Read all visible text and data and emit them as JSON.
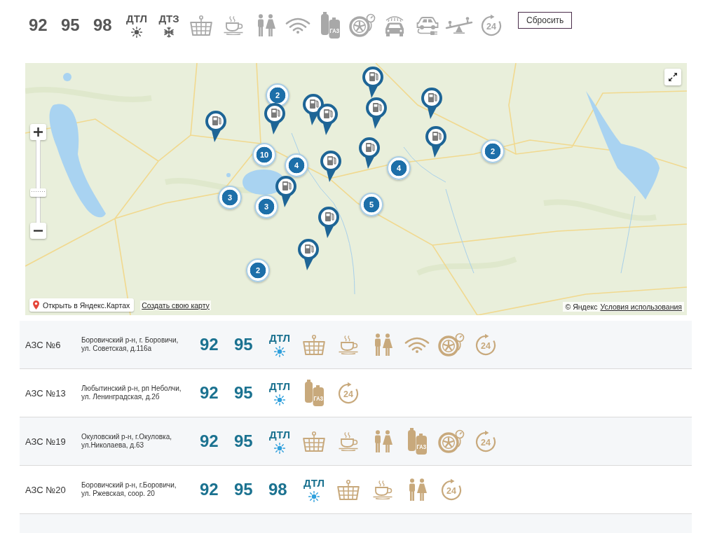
{
  "filters": {
    "fuels": [
      {
        "kind": "grade",
        "label": "92",
        "selected": false
      },
      {
        "kind": "grade",
        "label": "95",
        "selected": false
      },
      {
        "kind": "grade",
        "label": "98",
        "selected": false
      },
      {
        "kind": "summer",
        "label": "ДТЛ",
        "selected": false
      },
      {
        "kind": "winter",
        "label": "ДТЗ",
        "selected": false
      }
    ],
    "services": [
      {
        "kind": "shop",
        "selected": false
      },
      {
        "kind": "cafe",
        "selected": false
      },
      {
        "kind": "wc",
        "selected": false
      },
      {
        "kind": "wifi",
        "selected": false
      },
      {
        "kind": "gas",
        "label": "ГАЗ",
        "selected": false
      },
      {
        "kind": "tire",
        "selected": false
      },
      {
        "kind": "carwash",
        "selected": false
      },
      {
        "kind": "ev",
        "selected": false
      },
      {
        "kind": "playground",
        "selected": false
      },
      {
        "kind": "allday",
        "label": "24",
        "selected": false
      }
    ],
    "reset_button": "Сбросить"
  },
  "map": {
    "clusters": [
      {
        "count": "2"
      },
      {
        "count": "10"
      },
      {
        "count": "4"
      },
      {
        "count": "3"
      },
      {
        "count": "3"
      },
      {
        "count": "2"
      },
      {
        "count": "4"
      },
      {
        "count": "5"
      },
      {
        "count": "2"
      }
    ],
    "pins": [
      {
        "kind": "fuel"
      },
      {
        "kind": "fuel"
      },
      {
        "kind": "fuel"
      },
      {
        "kind": "fuel"
      },
      {
        "kind": "fuel"
      },
      {
        "kind": "fuel"
      },
      {
        "kind": "fuel"
      },
      {
        "kind": "fuel"
      },
      {
        "kind": "fuel"
      },
      {
        "kind": "fuel"
      },
      {
        "kind": "fuel"
      },
      {
        "kind": "fuel"
      },
      {
        "kind": "fuel"
      }
    ],
    "zoom": {
      "level": 0.35
    },
    "open_in_maps": "Открыть в Яндекс.Картах",
    "create_map": "Создать свою карту",
    "copyright": "© Яндекс",
    "terms": "Условия использования"
  },
  "stations": [
    {
      "name": "АЗС №6",
      "address": "Боровичский р-н, г. Боровичи,\nул. Советская, д.116а",
      "fuels": [
        {
          "kind": "grade",
          "label": "92"
        },
        {
          "kind": "grade",
          "label": "95"
        },
        {
          "kind": "summer",
          "label": "ДТЛ"
        }
      ],
      "services": [
        {
          "kind": "shop"
        },
        {
          "kind": "cafe"
        },
        {
          "kind": "wc"
        },
        {
          "kind": "wifi"
        },
        {
          "kind": "tire"
        },
        {
          "kind": "allday",
          "label": "24"
        }
      ]
    },
    {
      "name": "АЗС №13",
      "address": "Любытинский р-н, рп Неболчи,\nул. Ленинградская, д.2б",
      "fuels": [
        {
          "kind": "grade",
          "label": "92"
        },
        {
          "kind": "grade",
          "label": "95"
        },
        {
          "kind": "summer",
          "label": "ДТЛ"
        }
      ],
      "services": [
        {
          "kind": "gas",
          "label": "ГАЗ"
        },
        {
          "kind": "allday",
          "label": "24"
        }
      ]
    },
    {
      "name": "АЗС №19",
      "address": "Окуловский р-н, г.Окуловка,\nул.Николаева, д.63",
      "fuels": [
        {
          "kind": "grade",
          "label": "92"
        },
        {
          "kind": "grade",
          "label": "95"
        },
        {
          "kind": "summer",
          "label": "ДТЛ"
        }
      ],
      "services": [
        {
          "kind": "shop"
        },
        {
          "kind": "cafe"
        },
        {
          "kind": "wc"
        },
        {
          "kind": "gas",
          "label": "ГАЗ"
        },
        {
          "kind": "tire"
        },
        {
          "kind": "allday",
          "label": "24"
        }
      ]
    },
    {
      "name": "АЗС №20",
      "address": "Боровичский р-н, г.Боровичи,\nул. Ржевская, соор. 20",
      "fuels": [
        {
          "kind": "grade",
          "label": "92"
        },
        {
          "kind": "grade",
          "label": "95"
        },
        {
          "kind": "grade",
          "label": "98"
        },
        {
          "kind": "summer",
          "label": "ДТЛ"
        }
      ],
      "services": [
        {
          "kind": "shop"
        },
        {
          "kind": "cafe"
        },
        {
          "kind": "wc"
        },
        {
          "kind": "allday",
          "label": "24"
        }
      ]
    }
  ]
}
